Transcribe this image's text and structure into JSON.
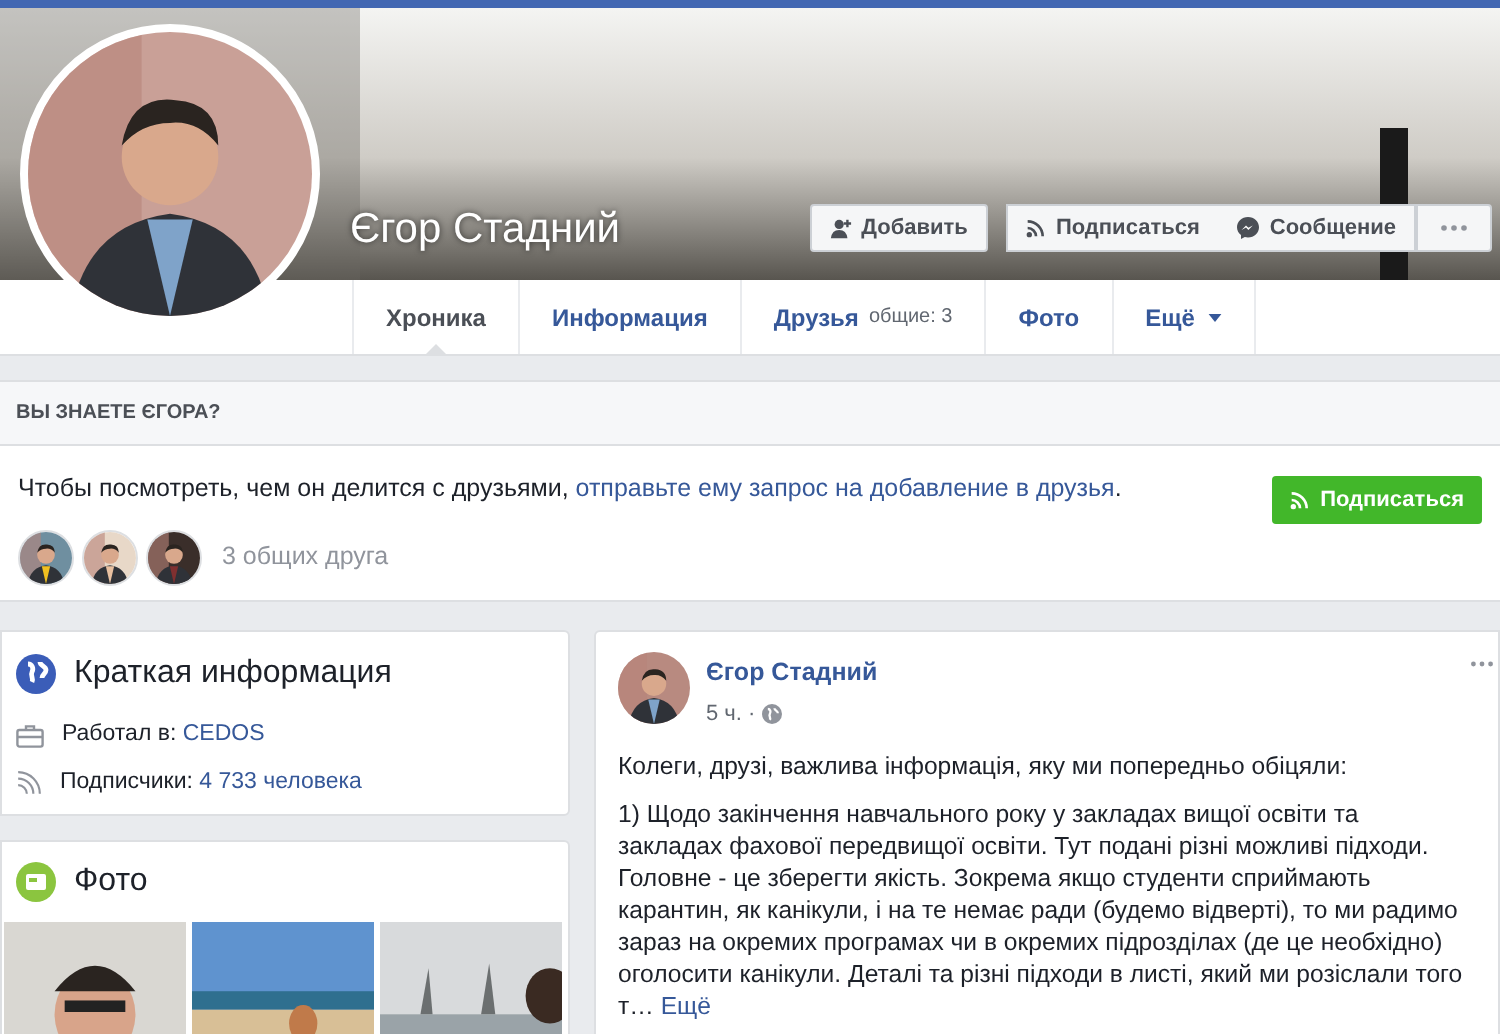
{
  "profile": {
    "name": "Єгор Стадний",
    "actions": [
      {
        "kind": "add",
        "label": "Добавить"
      },
      {
        "kind": "follow",
        "label": "Подписаться"
      },
      {
        "kind": "message",
        "label": "Сообщение"
      },
      {
        "kind": "more"
      }
    ]
  },
  "tabs": [
    {
      "label": "Хроника",
      "selected": true
    },
    {
      "label": "Информация",
      "selected": false
    },
    {
      "label": "Друзья",
      "badge": "общие: 3",
      "selected": false
    },
    {
      "label": "Фото",
      "selected": false
    },
    {
      "label": "Ещё",
      "dropdown": true,
      "selected": false
    }
  ],
  "know_panel": {
    "title": "ВЫ ЗНАЕТЕ ЄГОРА?",
    "text": "Чтобы посмотреть, чем он делится с друзьями, ",
    "link": "отправьте ему запрос на добавление в друзья",
    "text_end": ".",
    "button": "Подписаться",
    "mutual_friends": [
      {
        "kind": "avatar"
      },
      {
        "kind": "avatar"
      },
      {
        "kind": "avatar"
      }
    ],
    "mutual_count": "3 общих друга"
  },
  "intro": {
    "title": "Краткая информация",
    "items": [
      {
        "kind": "work",
        "label": "Работал в: ",
        "value": "CEDOS"
      },
      {
        "kind": "followers",
        "label": "Подписчики: ",
        "value": "4 733 человека"
      }
    ]
  },
  "photos": {
    "title": "Фото"
  },
  "post": {
    "author": "Єгор Стадний",
    "time": "5 ч.",
    "separator": "·",
    "paragraphs": [
      "Колеги, друзі, важлива інформація, яку ми попередньо обіцяли:",
      "1) Щодо закінчення навчального року у закладах вищої освіти та закладах фахової передвищої освіти. Тут подані різні можливі підходи. Головне - це зберегти якість. Зокрема якщо студенти сприймають карантин, як канікули, і на те немає ради (будемо відверті), то ми радимо зараз на окремих програмах чи в окремих підрозділах (де це необхідно) оголосити канікули. Деталі та різні підходи в листі, який ми розіслали того т… "
    ],
    "more": "Ещё"
  }
}
